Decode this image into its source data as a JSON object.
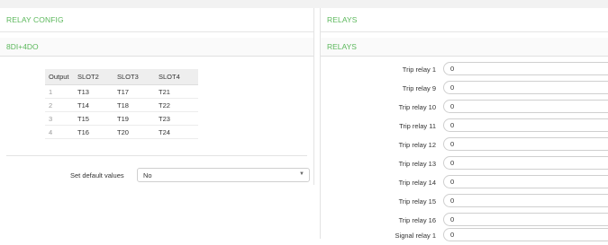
{
  "left": {
    "header": "RELAY CONFIG",
    "subheader": "8DI+4DO",
    "table": {
      "headers": [
        "Output",
        "SLOT2",
        "SLOT3",
        "SLOT4"
      ],
      "rows": [
        [
          "1",
          "T13",
          "T17",
          "T21"
        ],
        [
          "2",
          "T14",
          "T18",
          "T22"
        ],
        [
          "3",
          "T15",
          "T19",
          "T23"
        ],
        [
          "4",
          "T16",
          "T20",
          "T24"
        ]
      ]
    },
    "default_label": "Set default values",
    "default_value": "No"
  },
  "right": {
    "header": "RELAYS",
    "subheader": "RELAYS",
    "relays": [
      {
        "label": "Trip relay 1",
        "value": "0"
      },
      {
        "label": "Trip relay 9",
        "value": "0"
      },
      {
        "label": "Trip relay 10",
        "value": "0"
      },
      {
        "label": "Trip relay 11",
        "value": "0"
      },
      {
        "label": "Trip relay 12",
        "value": "0"
      },
      {
        "label": "Trip relay 13",
        "value": "0"
      },
      {
        "label": "Trip relay 14",
        "value": "0"
      },
      {
        "label": "Trip relay 15",
        "value": "0"
      },
      {
        "label": "Trip relay 16",
        "value": "0"
      },
      {
        "label": "Signal relay 1",
        "value": "0"
      }
    ]
  }
}
